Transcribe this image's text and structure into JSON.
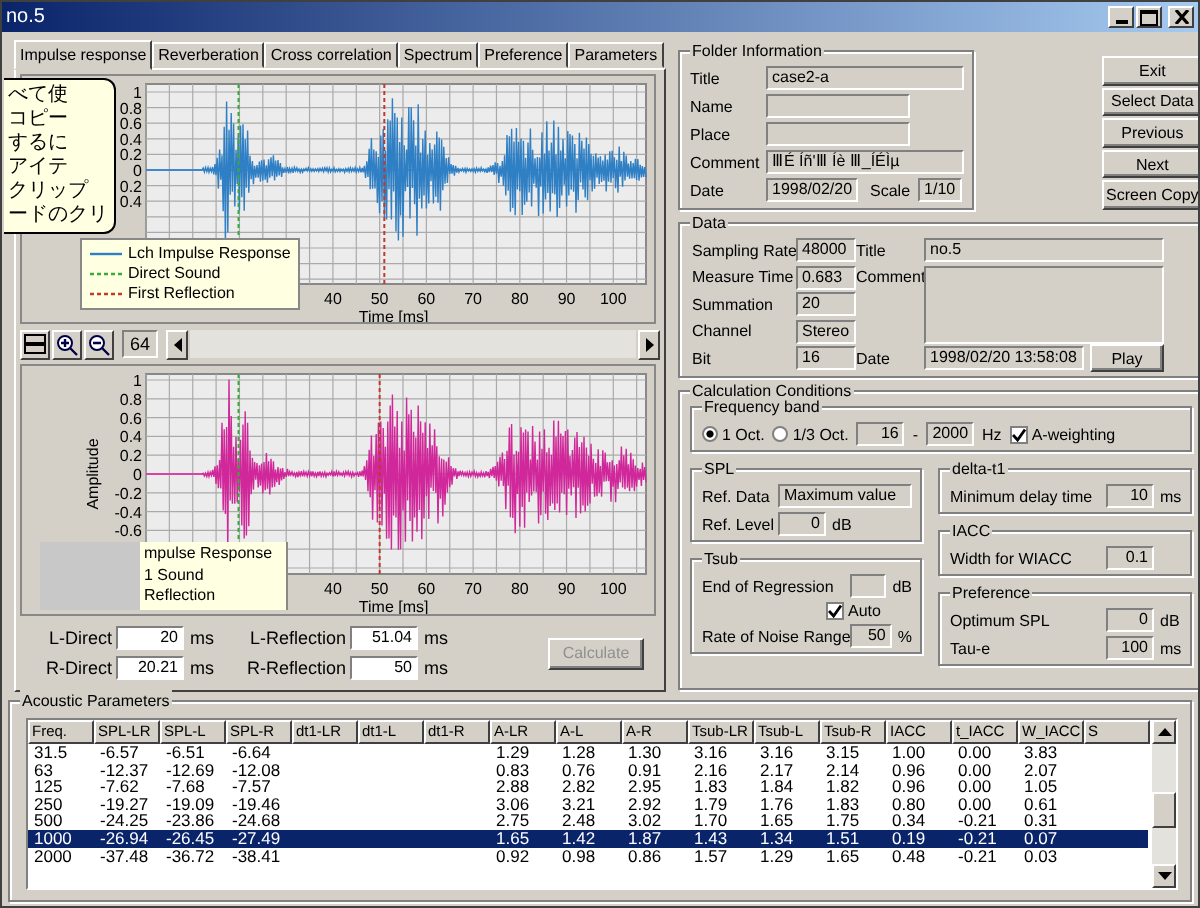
{
  "window": {
    "title": "no.5"
  },
  "tabs": [
    {
      "label": "Impulse response",
      "selected": true
    },
    {
      "label": "Reverberation",
      "selected": false
    },
    {
      "label": "Cross correlation",
      "selected": false
    },
    {
      "label": "Spectrum",
      "selected": false
    },
    {
      "label": "Preference",
      "selected": false
    },
    {
      "label": "Parameters",
      "selected": false
    }
  ],
  "tooltip": {
    "lines": [
      "べて使",
      "コピー",
      "するに",
      "アイテ",
      "クリップ",
      "ードのクリ"
    ]
  },
  "impulse_chart": {
    "yticks": [
      "1",
      "0.8",
      "0.6",
      "0.4",
      "0.2",
      "0",
      "0.2",
      "0.4"
    ],
    "xticks": [
      "40",
      "50",
      "60",
      "70",
      "80",
      "90",
      "100"
    ],
    "xlabel": "Time [ms]",
    "legend": [
      {
        "label": "Lch Impulse Response",
        "kind": "signal"
      },
      {
        "label": "Direct Sound",
        "kind": "direct"
      },
      {
        "label": "First Reflection",
        "kind": "reflection"
      }
    ]
  },
  "chart_toolbar": {
    "zoom_value": "64"
  },
  "amplitude_chart": {
    "ylabel": "Amplitude",
    "yticks": [
      "1",
      "0.8",
      "0.6",
      "0.4",
      "0.2",
      "0",
      "-0.2",
      "-0.4",
      "-0.6"
    ],
    "xticks": [
      "40",
      "50",
      "60",
      "70",
      "80",
      "90",
      "100"
    ],
    "xlabel": "Time [ms]",
    "legend": [
      "mpulse Response",
      "1 Sound",
      "Reflection"
    ]
  },
  "reflection_fields": [
    {
      "label": "L-Direct",
      "value": "20",
      "unit": "ms"
    },
    {
      "label": "L-Reflection",
      "value": "51.04",
      "unit": "ms"
    },
    {
      "label": "R-Direct",
      "value": "20.21",
      "unit": "ms"
    },
    {
      "label": "R-Reflection",
      "value": "50",
      "unit": "ms"
    }
  ],
  "calculate_button": {
    "label": "Calculate",
    "disabled": true
  },
  "folder_info": {
    "title": "Folder Information",
    "fields": [
      {
        "label": "Title",
        "value": "case2-a"
      },
      {
        "label": "Name"
      },
      {
        "label": "Place"
      },
      {
        "label": "Comment",
        "value": "ⅢÉ Íñ'Ⅲ Íè Ⅲ_ÍÉÌµ"
      },
      {
        "label": "Date",
        "value": "1998/02/20"
      }
    ],
    "scale": {
      "label": "Scale",
      "value": "1/10"
    }
  },
  "actions": [
    "Exit",
    "Select Data",
    "Previous",
    "Next",
    "Screen Copy"
  ],
  "data": {
    "title": "Data",
    "fields": [
      {
        "label": "Sampling Rate",
        "value": "48000"
      },
      {
        "label": "Measure Time",
        "value": "0.683"
      },
      {
        "label": "Summation",
        "value": "20"
      },
      {
        "label": "Channel",
        "value": "Stereo"
      },
      {
        "label": "Bit",
        "value": "16"
      }
    ],
    "title_field": {
      "label": "Title",
      "value": "no.5"
    },
    "comment_label": "Comment",
    "date_field": {
      "label": "Date",
      "value": "1998/02/20 13:58:08"
    },
    "play_button": "Play"
  },
  "calculation": {
    "title": "Calculation Conditions",
    "frequency_band": {
      "title": "Frequency band",
      "options": [
        {
          "label": "1 Oct.",
          "selected": true
        },
        {
          "label": "1/3 Oct.",
          "selected": false
        }
      ],
      "from": "16",
      "separator": "-",
      "to": "2000",
      "unit": "Hz",
      "a_weighting": {
        "label": "A-weighting",
        "checked": true
      }
    },
    "spl": {
      "title": "SPL",
      "ref_data_label": "Ref. Data",
      "ref_data": "Maximum value",
      "ref_level_label": "Ref. Level",
      "ref_level": "0",
      "unit": "dB"
    },
    "tsub": {
      "title": "Tsub",
      "end_label": "End of Regression",
      "end_unit": "dB",
      "auto": {
        "label": "Auto",
        "checked": true
      },
      "noise_label": "Rate of Noise Range",
      "noise": "50",
      "noise_unit": "%"
    },
    "delta_t1": {
      "title": "delta-t1",
      "label": "Minimum delay time",
      "value": "10",
      "unit": "ms"
    },
    "iacc": {
      "title": "IACC",
      "label": "Width for WIACC",
      "value": "0.1"
    },
    "preference": {
      "title": "Preference",
      "fields": [
        {
          "label": "Optimum SPL",
          "value": "0",
          "unit": "dB"
        },
        {
          "label": "Tau-e",
          "value": "100",
          "unit": "ms"
        }
      ]
    }
  },
  "acoustic": {
    "title": "Acoustic Parameters",
    "columns": [
      "Freq.",
      "SPL-LR",
      "SPL-L",
      "SPL-R",
      "dt1-LR",
      "dt1-L",
      "dt1-R",
      "A-LR",
      "A-L",
      "A-R",
      "Tsub-LR",
      "Tsub-L",
      "Tsub-R",
      "IACC",
      "t_IACC",
      "W_IACC",
      "S"
    ],
    "rows": [
      {
        "freq": "31.5",
        "spl": [
          "-6.57",
          "-6.51",
          "-6.64"
        ],
        "a": [
          "1.29",
          "1.28",
          "1.30"
        ],
        "tsub": [
          "3.16",
          "3.16",
          "3.15"
        ],
        "iacc": "1.00",
        "t_iacc": "0.00",
        "w_iacc": "3.83",
        "selected": false
      },
      {
        "freq": "63",
        "spl": [
          "-12.37",
          "-12.69",
          "-12.08"
        ],
        "a": [
          "0.83",
          "0.76",
          "0.91"
        ],
        "tsub": [
          "2.16",
          "2.17",
          "2.14"
        ],
        "iacc": "0.96",
        "t_iacc": "0.00",
        "w_iacc": "2.07",
        "selected": false
      },
      {
        "freq": "125",
        "spl": [
          "-7.62",
          "-7.68",
          "-7.57"
        ],
        "a": [
          "2.88",
          "2.82",
          "2.95"
        ],
        "tsub": [
          "1.83",
          "1.84",
          "1.82"
        ],
        "iacc": "0.96",
        "t_iacc": "0.00",
        "w_iacc": "1.05",
        "selected": false
      },
      {
        "freq": "250",
        "spl": [
          "-19.27",
          "-19.09",
          "-19.46"
        ],
        "a": [
          "3.06",
          "3.21",
          "2.92"
        ],
        "tsub": [
          "1.79",
          "1.76",
          "1.83"
        ],
        "iacc": "0.80",
        "t_iacc": "0.00",
        "w_iacc": "0.61",
        "selected": false
      },
      {
        "freq": "500",
        "spl": [
          "-24.25",
          "-23.86",
          "-24.68"
        ],
        "a": [
          "2.75",
          "2.48",
          "3.02"
        ],
        "tsub": [
          "1.70",
          "1.65",
          "1.75"
        ],
        "iacc": "0.34",
        "t_iacc": "-0.21",
        "w_iacc": "0.31",
        "selected": false
      },
      {
        "freq": "1000",
        "spl": [
          "-26.94",
          "-26.45",
          "-27.49"
        ],
        "a": [
          "1.65",
          "1.42",
          "1.87"
        ],
        "tsub": [
          "1.43",
          "1.34",
          "1.51"
        ],
        "iacc": "0.19",
        "t_iacc": "-0.21",
        "w_iacc": "0.07",
        "selected": true
      },
      {
        "freq": "2000",
        "spl": [
          "-37.48",
          "-36.72",
          "-38.41"
        ],
        "a": [
          "0.92",
          "0.98",
          "0.86"
        ],
        "tsub": [
          "1.57",
          "1.29",
          "1.65"
        ],
        "iacc": "0.48",
        "t_iacc": "-0.21",
        "w_iacc": "0.03",
        "selected": false
      }
    ]
  }
}
